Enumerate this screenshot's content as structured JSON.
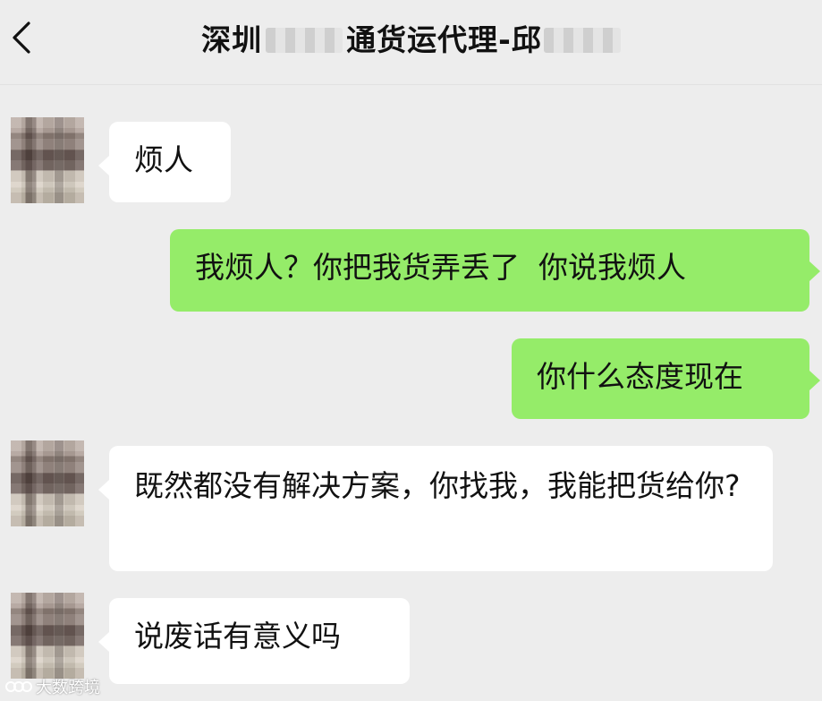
{
  "header": {
    "title_prefix": "深圳",
    "title_suffix": "通货运代理-邱",
    "back_icon": "chevron-left-icon"
  },
  "messages": [
    {
      "side": "left",
      "text": "烦人"
    },
    {
      "side": "right",
      "text": "我烦人？你把我货弄丢了  你说我烦人"
    },
    {
      "side": "right",
      "text": "你什么态度现在"
    },
    {
      "side": "left",
      "text": "既然都没有解决方案，你找我，我能把货给你?"
    },
    {
      "side": "left",
      "text": "说废话有意义吗"
    }
  ],
  "watermark": {
    "text": "大数跨境",
    "icon": "logo-icon"
  },
  "colors": {
    "background": "#ededed",
    "incoming_bubble": "#ffffff",
    "outgoing_bubble": "#95ec69"
  }
}
